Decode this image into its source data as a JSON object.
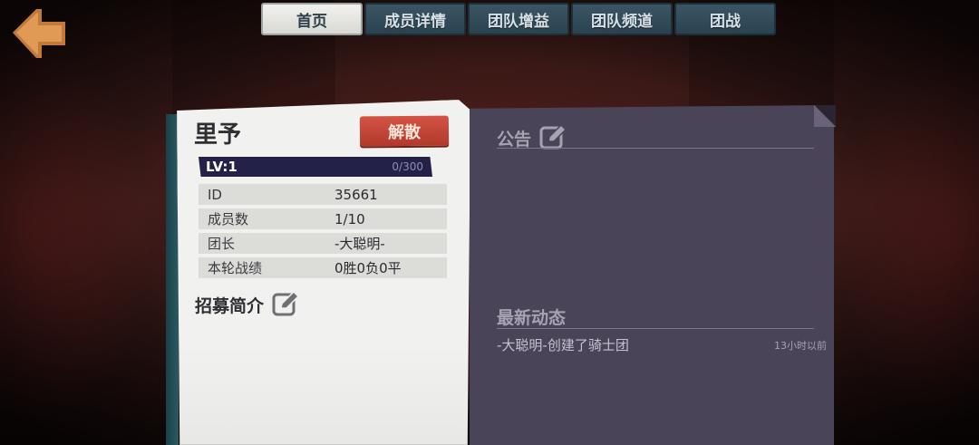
{
  "tabs": [
    {
      "label": "首页",
      "active": true
    },
    {
      "label": "成员详情",
      "active": false
    },
    {
      "label": "团队增益",
      "active": false
    },
    {
      "label": "团队频道",
      "active": false
    },
    {
      "label": "团战",
      "active": false
    }
  ],
  "team": {
    "name": "里予",
    "disband_label": "解散",
    "level_label": "LV:1",
    "xp_text": "0/300",
    "xp_fraction": 0.0,
    "info": [
      {
        "key": "ID",
        "value": "35661"
      },
      {
        "key": "成员数",
        "value": "1/10"
      },
      {
        "key": "团长",
        "value": "-大聪明-"
      },
      {
        "key": "本轮战绩",
        "value": "0胜0负0平"
      }
    ],
    "recruit_title": "招募简介"
  },
  "notice": {
    "title": "公告"
  },
  "activity": {
    "title": "最新动态",
    "items": [
      {
        "text": "-大聪明-创建了骑士团",
        "time": "13小时以前"
      }
    ]
  },
  "icons": {
    "back": "back-arrow-icon",
    "edit": "edit-pencil-icon"
  },
  "colors": {
    "back_arrow": "#d48a45",
    "active_tab": "#eeeeeb",
    "inactive_tab": "#34505e",
    "disband": "#c4473a",
    "level_bar": "#242148",
    "panel": "#4a4458",
    "paper": "#f1f1ef"
  }
}
